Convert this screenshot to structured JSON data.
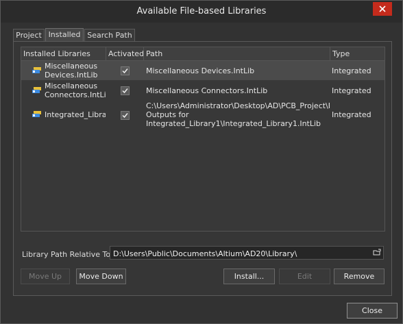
{
  "window": {
    "title": "Available File-based Libraries"
  },
  "tabs": [
    {
      "label": "Project"
    },
    {
      "label": "Installed"
    },
    {
      "label": "Search Path"
    }
  ],
  "table": {
    "columns": [
      "Installed Libraries",
      "Activated",
      "Path",
      "Type"
    ],
    "rows": [
      {
        "name_line1": "Miscellaneous",
        "name_line2": "Devices.IntLib",
        "activated": true,
        "path": "Miscellaneous Devices.IntLib",
        "type": "Integrated"
      },
      {
        "name_line1": "Miscellaneous",
        "name_line2": "Connectors.IntLib",
        "activated": true,
        "path": "Miscellaneous Connectors.IntLib",
        "type": "Integrated"
      },
      {
        "name_line1": "Integrated_Librar",
        "activated": true,
        "path_line1": "C:\\Users\\Administrator\\Desktop\\AD\\PCB_Project\\Proj",
        "path_line2": "Outputs for",
        "path_line3": "Integrated_Library1\\Integrated_Library1.IntLib",
        "type": "Integrated"
      }
    ]
  },
  "library_path": {
    "label": "Library Path Relative To:",
    "value": "D:\\Users\\Public\\Documents\\Altium\\AD20\\Library\\"
  },
  "buttons": {
    "move_up": "Move Up",
    "move_down": "Move Down",
    "install": "Install...",
    "edit": "Edit",
    "remove": "Remove",
    "close": "Close"
  },
  "colors": {
    "close_red": "#c42b1c",
    "selected_row": "#4b4b4b"
  },
  "icons": {
    "close": "close-icon",
    "library": "library-icon",
    "check": "checkmark-icon",
    "open_folder": "folder-open-icon"
  }
}
